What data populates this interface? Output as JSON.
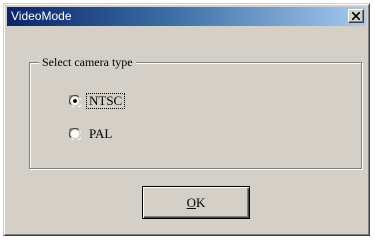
{
  "window": {
    "title": "VideoMode"
  },
  "titlebar_buttons": {
    "close_icon": "close-icon"
  },
  "camera_group": {
    "label": "Select camera type",
    "options": [
      {
        "label": "NTSC",
        "selected": true,
        "focused": true
      },
      {
        "label": "PAL",
        "selected": false,
        "focused": false
      }
    ]
  },
  "ok_button": {
    "mnemonic": "O",
    "rest": "K"
  },
  "colors": {
    "title_gradient_start": "#0a246a",
    "title_gradient_end": "#a6caf0",
    "dialog_face": "#d4d0c8"
  }
}
